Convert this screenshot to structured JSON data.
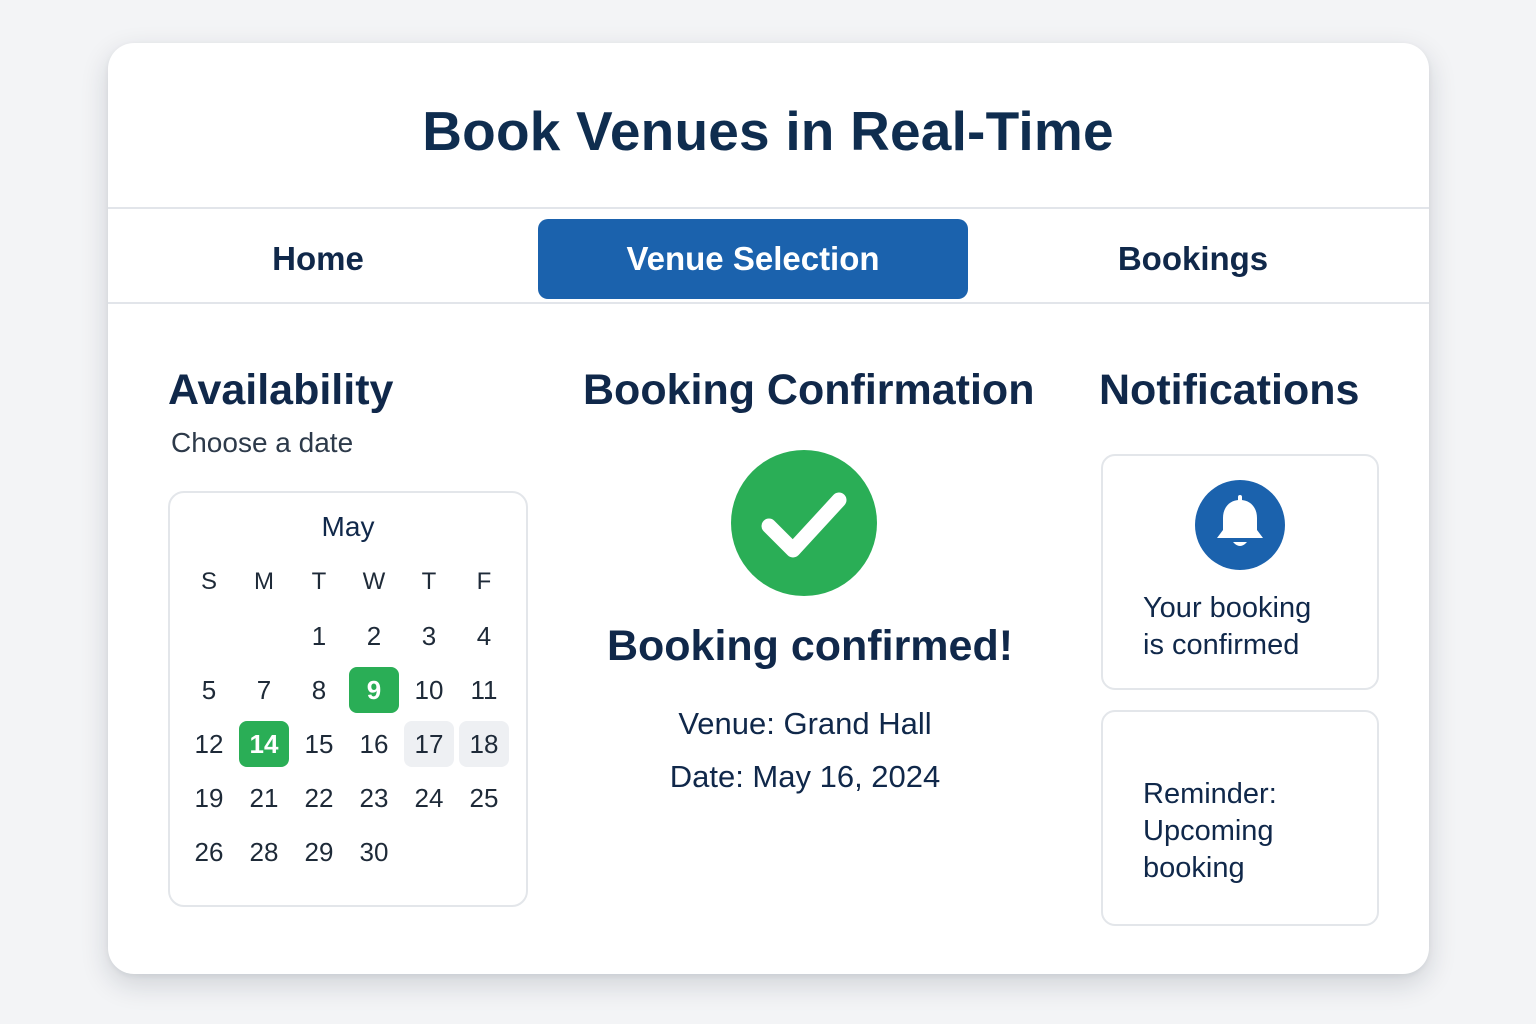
{
  "header": {
    "title": "Book Venues in Real-Time"
  },
  "nav": {
    "tabs": [
      {
        "label": "Home"
      },
      {
        "label": "Venue Selection",
        "active": true
      },
      {
        "label": "Bookings"
      }
    ]
  },
  "availability": {
    "heading": "Availability",
    "subtitle": "Choose a date",
    "calendar": {
      "month": "May",
      "weekdays": [
        "S",
        "M",
        "T",
        "W",
        "T",
        "F"
      ],
      "days": [
        [
          "",
          "",
          "1",
          "2",
          "3",
          "4"
        ],
        [
          "5",
          "7",
          "8",
          "9",
          "10",
          "11"
        ],
        [
          "12",
          "14",
          "15",
          "16",
          "17",
          "18"
        ],
        [
          "19",
          "21",
          "22",
          "23",
          "24",
          "25"
        ],
        [
          "26",
          "28",
          "29",
          "30",
          "",
          ""
        ]
      ],
      "selected_days": [
        "9",
        "14"
      ],
      "unavailable_days": [
        "17",
        "18"
      ]
    }
  },
  "confirmation": {
    "heading": "Booking Confirmation",
    "icon": "checkmark-circle-icon",
    "message": "Booking confirmed!",
    "venue": "Venue: Grand Hall",
    "date": "Date: May 16, 2024"
  },
  "notifications": {
    "heading": "Notifications",
    "items": [
      {
        "icon": "bell-icon",
        "line1": "Your booking",
        "line2": "is confirmed"
      },
      {
        "line1": "Reminder:",
        "line2": "Upcoming",
        "line3": "booking"
      }
    ]
  },
  "colors": {
    "accent": "#1b62ad",
    "success": "#2aae56",
    "text": "#10284a"
  }
}
